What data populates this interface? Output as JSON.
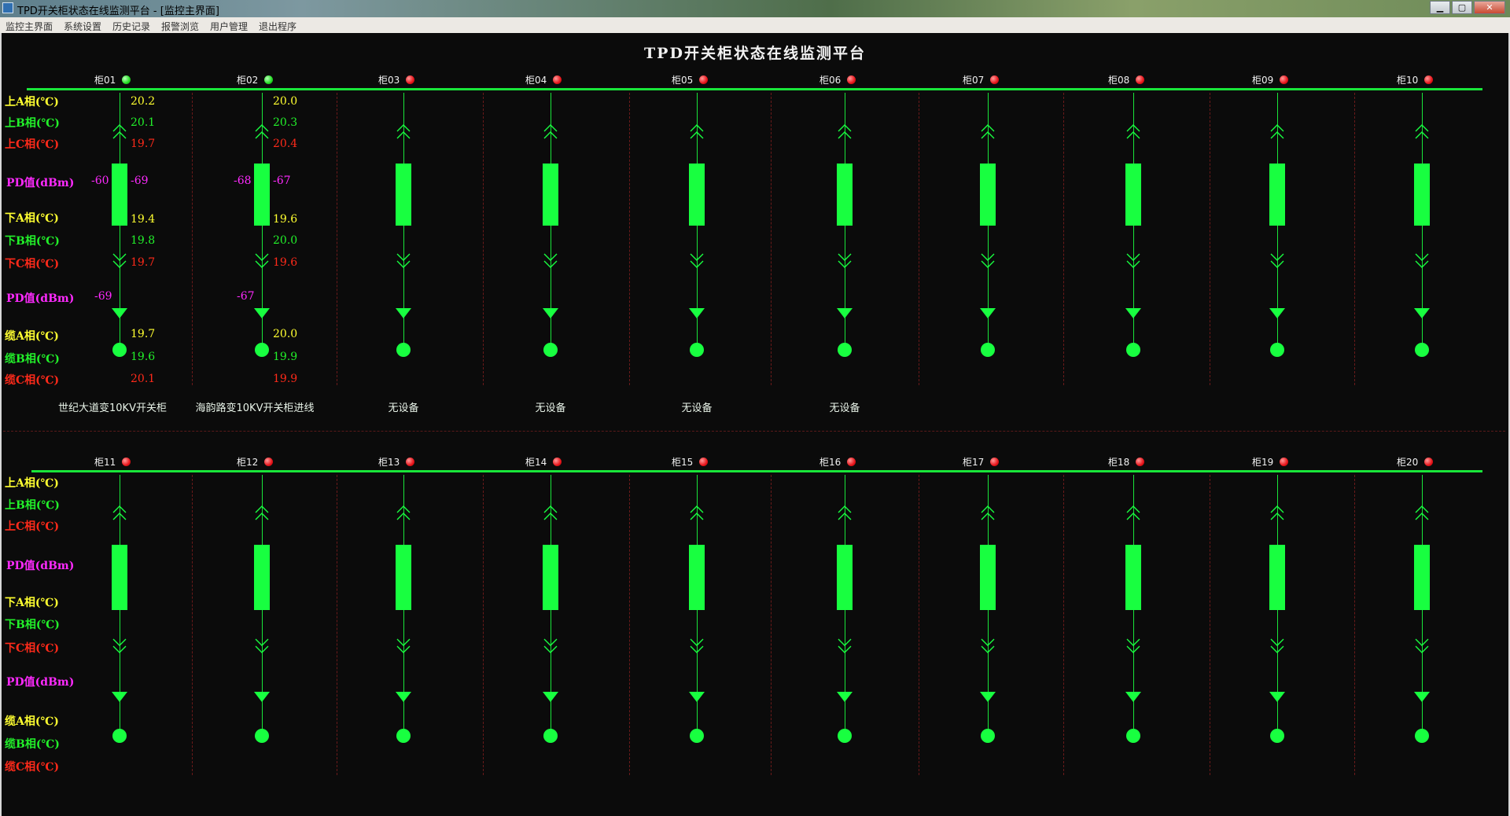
{
  "window": {
    "title": "TPD开关柜状态在线监测平台 - [监控主界面]",
    "minimize": "▁",
    "maximize": "▢",
    "close": "✕"
  },
  "menu": [
    "监控主界面",
    "系统设置",
    "历史记录",
    "报警浏览",
    "用户管理",
    "退出程序"
  ],
  "main_title": "TPD开关柜状态在线监测平台",
  "colors": {
    "bus": "#19e63a",
    "breaker": "#18ff40",
    "status_red": "#e8151b",
    "status_green": "#22dd22",
    "label_yellow": "#ffff30",
    "label_green": "#22f02a",
    "label_red": "#ff2a1a",
    "label_magenta": "#ff2aff"
  },
  "row_labels": {
    "upper_a": "上A相(℃)",
    "upper_b": "上B相(℃)",
    "upper_c": "上C相(℃)",
    "pd1": "PD值(dBm)",
    "lower_a": "下A相(℃)",
    "lower_b": "下B相(℃)",
    "lower_c": "下C相(℃)",
    "pd2": "PD值(dBm)",
    "cable_a": "缆A相(℃)",
    "cable_b": "缆B相(℃)",
    "cable_c": "缆C相(℃)"
  },
  "rows": [
    {
      "cabinets": [
        {
          "id": "柜01",
          "status": "green",
          "upper": [
            "20.2",
            "20.1",
            "19.7"
          ],
          "pd1_left": "-60",
          "pd1_right": "-69",
          "lower": [
            "19.4",
            "19.8",
            "19.7"
          ],
          "pd2": "-69",
          "cable": [
            "19.7",
            "19.6",
            "20.1"
          ],
          "device": "世纪大道变10KV开关柜"
        },
        {
          "id": "柜02",
          "status": "green",
          "upper": [
            "20.0",
            "20.3",
            "20.4"
          ],
          "pd1_left": "-68",
          "pd1_right": "-67",
          "lower": [
            "19.6",
            "20.0",
            "19.6"
          ],
          "pd2": "-67",
          "cable": [
            "20.0",
            "19.9",
            "19.9"
          ],
          "device": "海韵路变10KV开关柜进线"
        },
        {
          "id": "柜03",
          "status": "red",
          "device": "无设备"
        },
        {
          "id": "柜04",
          "status": "red",
          "device": "无设备"
        },
        {
          "id": "柜05",
          "status": "red",
          "device": "无设备"
        },
        {
          "id": "柜06",
          "status": "red",
          "device": "无设备"
        },
        {
          "id": "柜07",
          "status": "red",
          "device": ""
        },
        {
          "id": "柜08",
          "status": "red",
          "device": ""
        },
        {
          "id": "柜09",
          "status": "red",
          "device": ""
        },
        {
          "id": "柜10",
          "status": "red",
          "device": ""
        }
      ]
    },
    {
      "cabinets": [
        {
          "id": "柜11",
          "status": "red",
          "device": ""
        },
        {
          "id": "柜12",
          "status": "red",
          "device": ""
        },
        {
          "id": "柜13",
          "status": "red",
          "device": ""
        },
        {
          "id": "柜14",
          "status": "red",
          "device": ""
        },
        {
          "id": "柜15",
          "status": "red",
          "device": ""
        },
        {
          "id": "柜16",
          "status": "red",
          "device": ""
        },
        {
          "id": "柜17",
          "status": "red",
          "device": ""
        },
        {
          "id": "柜18",
          "status": "red",
          "device": ""
        },
        {
          "id": "柜19",
          "status": "red",
          "device": ""
        },
        {
          "id": "柜20",
          "status": "red",
          "device": ""
        }
      ]
    }
  ]
}
